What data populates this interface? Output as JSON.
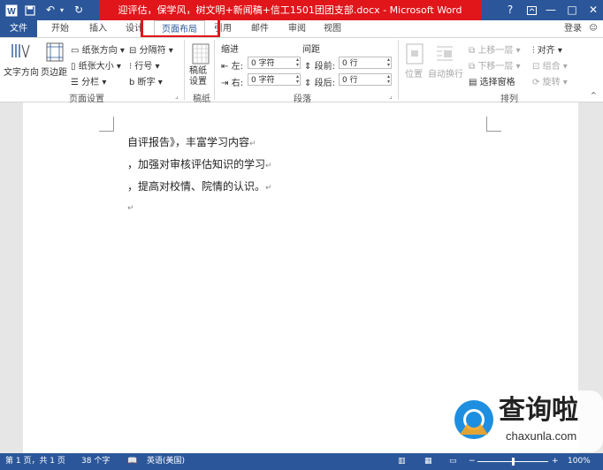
{
  "window": {
    "title": "迎评估，保学风，树文明+新闻稿+信工1501团团支部.docx - Microsoft Word",
    "help": "?",
    "minimize": "—",
    "restore": "□",
    "close": "✕",
    "signin": "登录"
  },
  "tabs": [
    "文件",
    "开始",
    "插入",
    "设计",
    "页面布局",
    "引用",
    "邮件",
    "审阅",
    "视图"
  ],
  "active_tab": "页面布局",
  "ribbon": {
    "page_setup": {
      "text_direction": "文字方向",
      "margins": "页边距",
      "orientation": "纸张方向",
      "size": "纸张大小",
      "columns": "分栏",
      "breaks": "分隔符",
      "line_numbers": "行号",
      "hyphenation": "断字",
      "label": "页面设置"
    },
    "manuscript": {
      "button": "稿纸设置",
      "label": "稿纸"
    },
    "paragraph": {
      "indent_header": "缩进",
      "spacing_header": "间距",
      "left_label": "左:",
      "right_label": "右:",
      "before_label": "段前:",
      "after_label": "段后:",
      "left_value": "0 字符",
      "right_value": "0 字符",
      "before_value": "0 行",
      "after_value": "0 行",
      "label": "段落"
    },
    "arrange": {
      "position": "位置",
      "wrap_text": "自动换行",
      "bring_forward": "上移一层",
      "send_backward": "下移一层",
      "selection_pane": "选择窗格",
      "align": "对齐",
      "group": "组合",
      "rotate": "旋转",
      "label": "排列"
    }
  },
  "document": {
    "lines": [
      "自评报告》，丰富学习内容",
      "，加强对审核评估知识的学习",
      "，提高对校情、院情的认识。"
    ],
    "paragraph_mark": "↵"
  },
  "status": {
    "page": "第 1 页，共 1 页",
    "words": "38 个字",
    "language": "英语(美国)",
    "zoom": "100%",
    "zoom_fraction": 0.5
  },
  "watermark": {
    "brand": "查询啦",
    "domain": "chaxunla.com"
  },
  "colors": {
    "word_blue": "#2b579a",
    "title_red": "#e0161b"
  }
}
